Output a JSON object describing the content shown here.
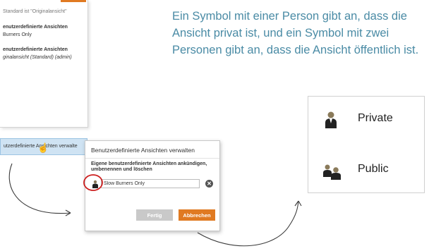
{
  "dropdown": {
    "default_note": "Standard ist \"Originalansicht\"",
    "group1_header": "enutzerdefinierte Ansichten",
    "group1_item": "Burners Only",
    "group2_header": "enutzerdefinierte Ansichten",
    "group2_item": "ginalansicht (Standard) (admin)",
    "manage_label": "utzerdefinierte Ansichten verwalte"
  },
  "explanation": "Ein Symbol mit einer Person gibt an, dass die Ansicht privat ist, und ein Symbol mit zwei Personen gibt an, dass die Ansicht öffentlich ist.",
  "legend": {
    "private_label": "Private",
    "public_label": "Public"
  },
  "dialog": {
    "title": "Benutzerdefinierte Ansichten verwalten",
    "description": "Eigene benutzerdefinierte Ansichten ankündigen, umbenennen und löschen",
    "view_name": "Slow Burners Only",
    "done_label": "Fertig",
    "cancel_label": "Abbrechen"
  },
  "colors": {
    "accent_orange": "#e07a22",
    "text_blue": "#4a8ba5",
    "highlight_blue": "#cfe3f3",
    "callout_red": "#cc1f1f"
  }
}
